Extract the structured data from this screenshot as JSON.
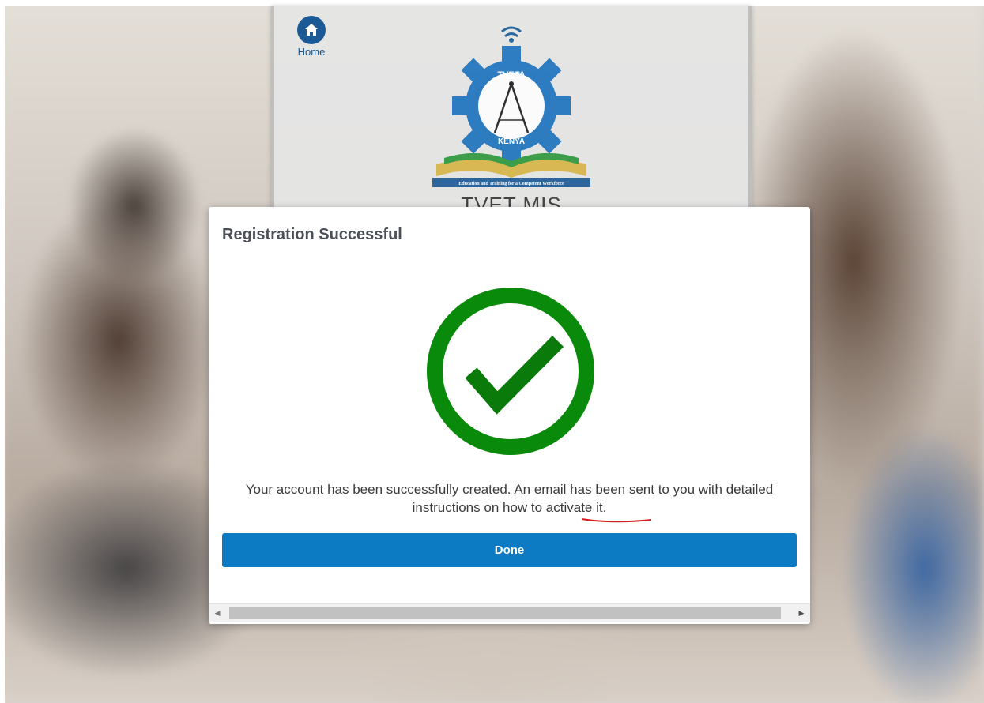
{
  "background": {
    "home_label": "Home",
    "logo_top_text": "TVETA",
    "logo_bottom_text": "KENYA",
    "logo_motto": "Education and Training for a Competent Workforce",
    "app_title": "TVET MIS"
  },
  "modal": {
    "title": "Registration Successful",
    "message": "Your account has been successfully created. An email has been sent to you with detailed instructions on how to activate it.",
    "done_label": "Done"
  },
  "colors": {
    "accent": "#0d7bc4",
    "success": "#0a8a0a",
    "brand": "#0b4f8f"
  },
  "icons": {
    "home": "home-icon",
    "success": "check-circle-icon"
  }
}
